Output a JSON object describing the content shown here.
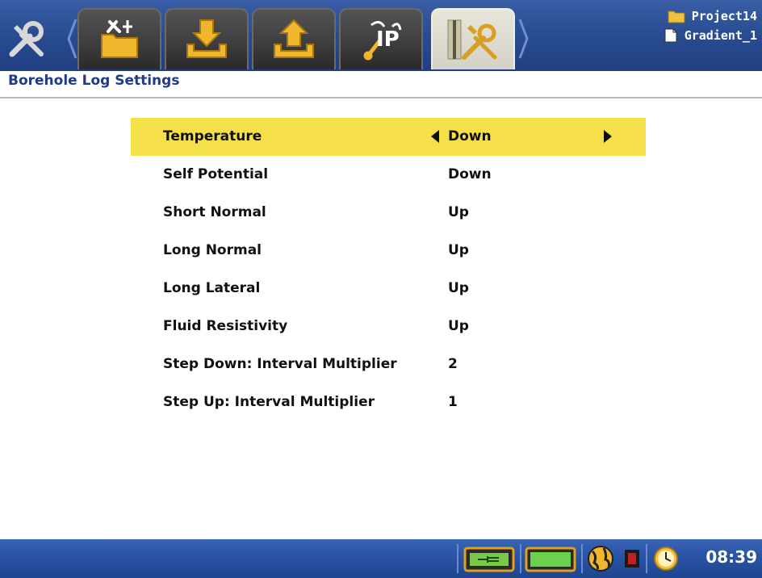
{
  "toolbar": {
    "tools_icon": "wrench-screwdriver-icon",
    "tabs": [
      {
        "icon": "project-folder-icon"
      },
      {
        "icon": "download-icon"
      },
      {
        "icon": "upload-icon"
      },
      {
        "icon": "ip-settings-icon"
      },
      {
        "icon": "borehole-settings-icon",
        "active": true
      }
    ]
  },
  "project": {
    "name": "Project14",
    "file": "Gradient_1"
  },
  "header": {
    "title": "Borehole Log Settings"
  },
  "settings": [
    {
      "label": "Temperature",
      "value": "Down",
      "selected": true
    },
    {
      "label": "Self Potential",
      "value": "Down"
    },
    {
      "label": "Short Normal",
      "value": "Up"
    },
    {
      "label": "Long Normal",
      "value": "Up"
    },
    {
      "label": "Long Lateral",
      "value": "Up"
    },
    {
      "label": "Fluid Resistivity",
      "value": "Up"
    },
    {
      "label": "Step Down: Interval Multiplier",
      "value": "2"
    },
    {
      "label": "Step Up: Interval Multiplier",
      "value": "1"
    }
  ],
  "statusbar": {
    "power_icon": "external-power-icon",
    "battery_icon": "battery-icon",
    "gps_icon": "globe-icon",
    "record_icon": "record-indicator-icon",
    "clock_icon": "clock-icon",
    "time": "08:39"
  },
  "colors": {
    "toolbar_blue": "#2a4d93",
    "selection_yellow": "#f5e04a",
    "title_blue": "#213a86",
    "status_blue": "#2a55a6"
  }
}
